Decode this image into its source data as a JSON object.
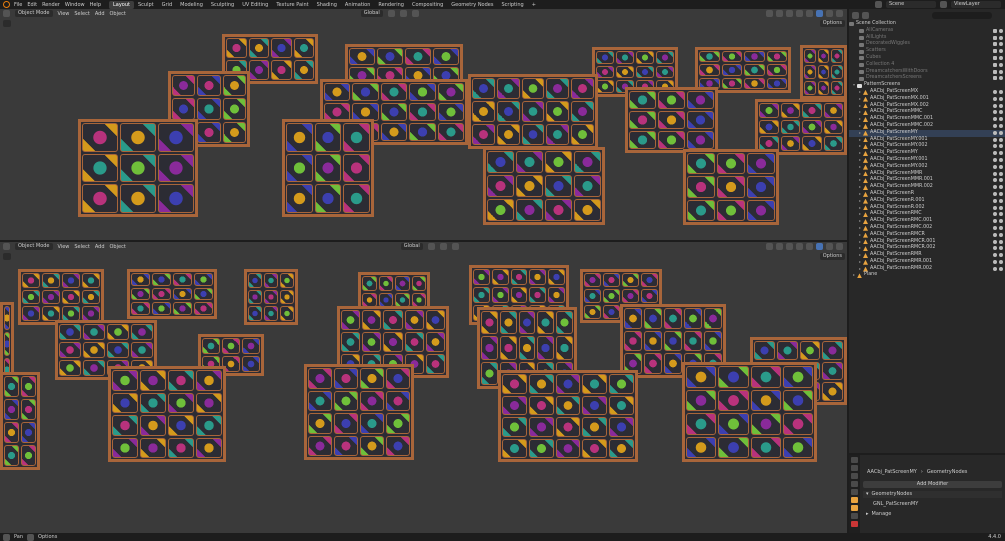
{
  "topbar": {
    "menu": [
      "File",
      "Edit",
      "Render",
      "Window",
      "Help"
    ],
    "workspaces": [
      "Layout",
      "Sculpt",
      "Grid",
      "Modeling",
      "Sculpting",
      "UV Editing",
      "Texture Paint",
      "Shading",
      "Animation",
      "Rendering",
      "Compositing",
      "Geometry Nodes",
      "Scripting"
    ],
    "active_workspace": "Layout",
    "add_tab": "+",
    "scene": "Scene",
    "view_layer": "ViewLayer"
  },
  "viewport1": {
    "mode": "Object Mode",
    "menus": [
      "View",
      "Select",
      "Add",
      "Object"
    ],
    "orientation": "Global",
    "options": "Options"
  },
  "viewport2": {
    "mode": "Object Mode",
    "menus": [
      "View",
      "Select",
      "Add",
      "Object"
    ],
    "orientation": "Global",
    "options": "Options"
  },
  "outliner": {
    "collection_root": "Scene Collection",
    "collections": [
      "AllCameras",
      "AllLights",
      "DecoratedWiggles",
      "Scatters",
      "Cubes",
      "Collection 4",
      "DreamcatchersWithDoors",
      "DreamcatchersScreens"
    ],
    "pattern_collection": "PatternScreens",
    "objects": [
      "AACbj_PatScreenMX",
      "AACbj_PatScreenMX.001",
      "AACbj_PatScreenMX.002",
      "AACbj_PatScreenMMC",
      "AACbj_PatScreenMMC.001",
      "AACbj_PatScreenMMC.002",
      "AACbj_PatScreenMY",
      "AACbj_PatScreenMY.001",
      "AACbj_PatScreenMY.002",
      "AACbj_PatScreenMY",
      "AACbj_PatScreenMY.001",
      "AACbj_PatScreenMY.002",
      "AACbj_PatScreenMMR",
      "AACbj_PatScreenMMR.001",
      "AACbj_PatScreenMMR.002",
      "AACbj_PatScreenR",
      "AACbj_PatScreenR.001",
      "AACbj_PatScreenR.002",
      "AACbj_PatScreenRMC",
      "AACbj_PatScreenRMC.001",
      "AACbj_PatScreenRMC.002",
      "AACbj_PatScreenRMCR",
      "AACbj_PatScreenRMCR.001",
      "AACbj_PatScreenRMCR.002",
      "AACbj_PatScreenRMR",
      "AACbj_PatScreenRMR.001",
      "AACbj_PatScreenRMR.002"
    ],
    "extra": "Plane"
  },
  "properties": {
    "object_name": "AACbj_PatScreenMY",
    "modifier_tab": "GeometryNodes",
    "add_modifier": "Add Modifier",
    "modifier_name": "GeometryNodes",
    "node_group": "GNL_PatScreenMY",
    "manage": "Manage"
  },
  "status": {
    "pan": "Pan",
    "options": "Options",
    "version": "4.4.0"
  },
  "colors": {
    "frame": "#a8653a",
    "accent": "#e87d0d",
    "select": "#4772b3"
  }
}
